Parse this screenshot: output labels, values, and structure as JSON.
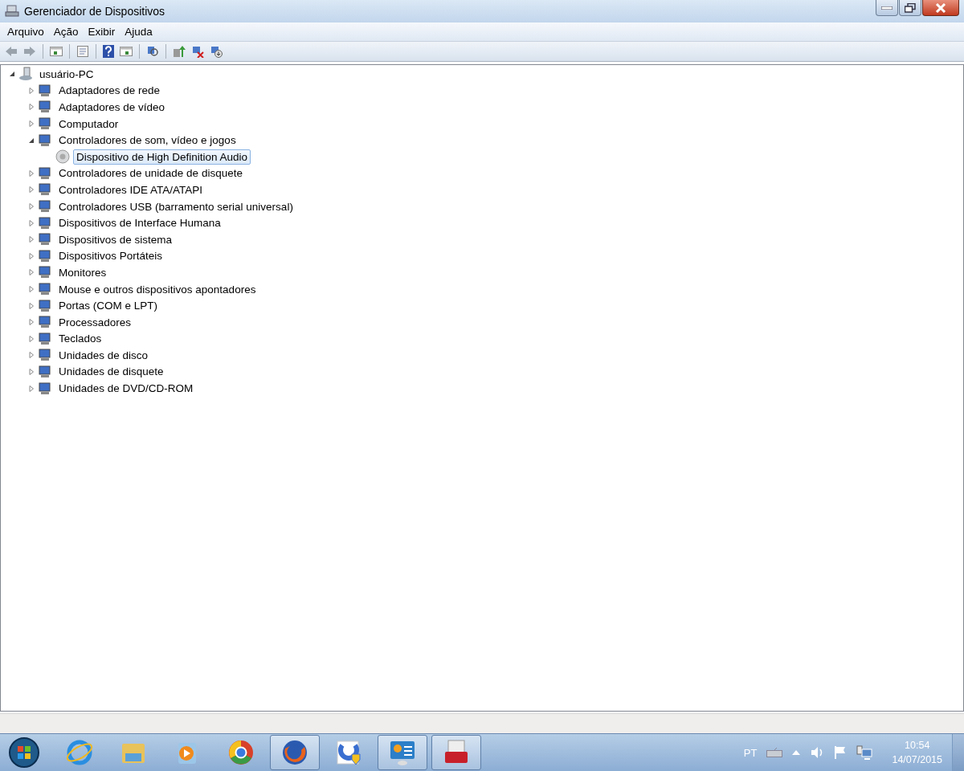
{
  "window": {
    "title": "Gerenciador de Dispositivos"
  },
  "menu": [
    "Arquivo",
    "Ação",
    "Exibir",
    "Ajuda"
  ],
  "tree": {
    "label": "usuário-PC",
    "expanded": true,
    "selected": false,
    "children": [
      {
        "label": "Adaptadores de rede",
        "expanded": false,
        "selected": false
      },
      {
        "label": "Adaptadores de vídeo",
        "expanded": false,
        "selected": false
      },
      {
        "label": "Computador",
        "expanded": false,
        "selected": false
      },
      {
        "label": "Controladores de som, vídeo e jogos",
        "expanded": true,
        "selected": false,
        "children": [
          {
            "label": "Dispositivo de High Definition Audio",
            "selected": true
          }
        ]
      },
      {
        "label": "Controladores de unidade de disquete",
        "expanded": false,
        "selected": false
      },
      {
        "label": "Controladores IDE ATA/ATAPI",
        "expanded": false,
        "selected": false
      },
      {
        "label": "Controladores USB (barramento serial universal)",
        "expanded": false,
        "selected": false
      },
      {
        "label": "Dispositivos de Interface Humana",
        "expanded": false,
        "selected": false
      },
      {
        "label": "Dispositivos de sistema",
        "expanded": false,
        "selected": false
      },
      {
        "label": "Dispositivos Portáteis",
        "expanded": false,
        "selected": false
      },
      {
        "label": "Monitores",
        "expanded": false,
        "selected": false
      },
      {
        "label": "Mouse e outros dispositivos apontadores",
        "expanded": false,
        "selected": false
      },
      {
        "label": "Portas (COM e LPT)",
        "expanded": false,
        "selected": false
      },
      {
        "label": "Processadores",
        "expanded": false,
        "selected": false
      },
      {
        "label": "Teclados",
        "expanded": false,
        "selected": false
      },
      {
        "label": "Unidades de disco",
        "expanded": false,
        "selected": false
      },
      {
        "label": "Unidades de disquete",
        "expanded": false,
        "selected": false
      },
      {
        "label": "Unidades de DVD/CD-ROM",
        "expanded": false,
        "selected": false
      }
    ]
  },
  "taskbar": {
    "apps": [
      {
        "kind": "browser-e",
        "open": false
      },
      {
        "kind": "folder",
        "open": false
      },
      {
        "kind": "player",
        "open": false
      },
      {
        "kind": "globe",
        "open": false
      },
      {
        "kind": "fox",
        "open": true
      },
      {
        "kind": "shield",
        "open": false
      },
      {
        "kind": "panel",
        "open": true
      },
      {
        "kind": "toolbox",
        "open": true
      }
    ],
    "language": "PT",
    "time": "10:54",
    "date": "14/07/2015"
  }
}
